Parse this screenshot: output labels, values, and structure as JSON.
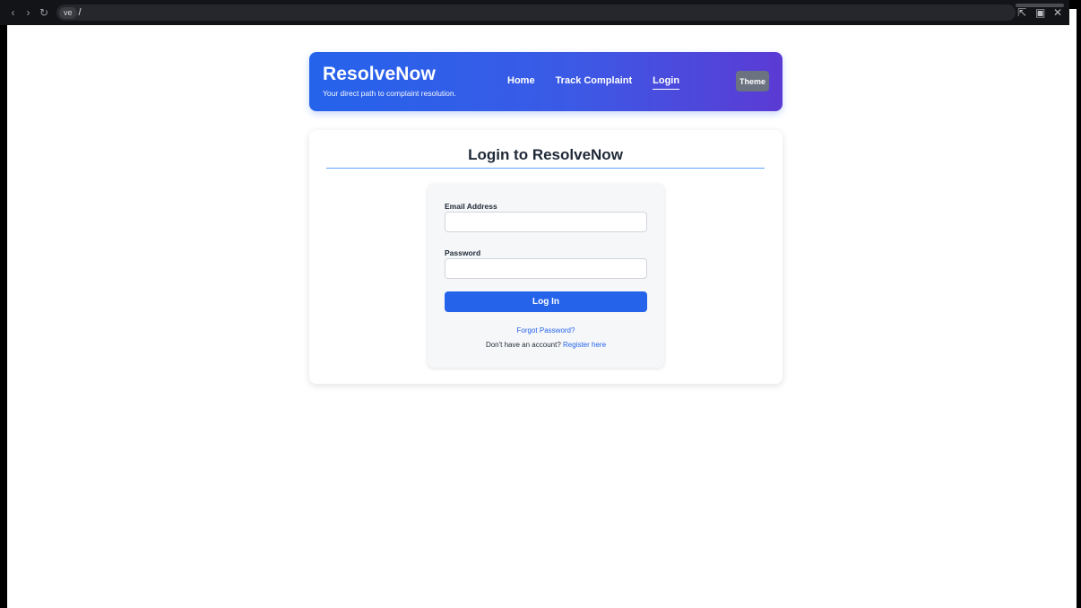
{
  "browser": {
    "url_pill": "ve",
    "url_path": "/",
    "back_glyph": "‹",
    "forward_glyph": "›",
    "reload_glyph": "↻",
    "icons": [
      "back-icon",
      "forward-icon",
      "reload-icon",
      "extension-icon",
      "window-icon",
      "close-icon"
    ]
  },
  "header": {
    "brand": "ResolveNow",
    "tagline": "Your direct path to complaint resolution.",
    "nav": [
      {
        "label": "Home"
      },
      {
        "label": "Track Complaint"
      },
      {
        "label": "Login",
        "active": true
      }
    ],
    "theme_button": "Theme"
  },
  "login": {
    "title": "Login to ResolveNow",
    "email_label": "Email Address",
    "email_value": "",
    "password_label": "Password",
    "password_value": "",
    "submit": "Log In",
    "forgot": "Forgot Password?",
    "no_account": "Don't have an account?",
    "register": "Register here"
  },
  "colors": {
    "accent": "#2563eb",
    "header_gradient_start": "#2563eb",
    "header_gradient_end": "#5b3bd4",
    "theme_button_bg": "#6b7280",
    "divider": "#60a5fa"
  }
}
